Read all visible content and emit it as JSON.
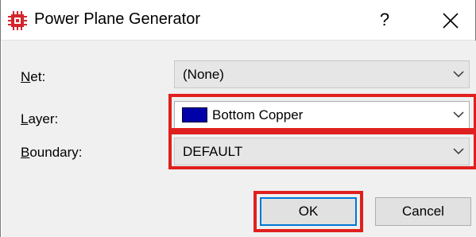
{
  "window": {
    "title": "Power Plane Generator",
    "help_glyph": "?",
    "close_glyph": "✕"
  },
  "form": {
    "net": {
      "label_key": "N",
      "label_rest": "et:",
      "value": "(None)"
    },
    "layer": {
      "label_key": "L",
      "label_rest": "ayer:",
      "value": "Bottom Copper",
      "swatch_color": "#0000a8"
    },
    "boundary": {
      "label_key": "B",
      "label_rest": "oundary:",
      "value": "DEFAULT"
    }
  },
  "buttons": {
    "ok": "OK",
    "cancel": "Cancel"
  },
  "icons": {
    "app": "chip-icon",
    "dropdown": "chevron-down-icon"
  },
  "colors": {
    "highlight": "#e0201e",
    "layer_swatch": "#0000a8",
    "app_icon_red": "#d4262c"
  }
}
